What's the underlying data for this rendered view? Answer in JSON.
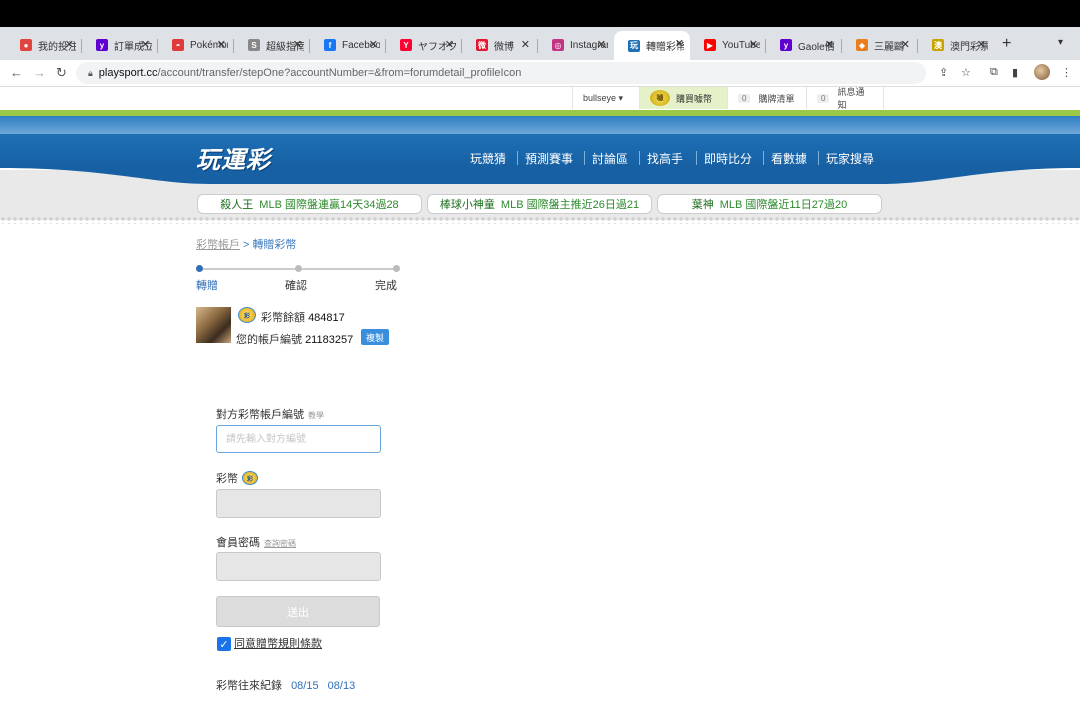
{
  "browser": {
    "tabs": [
      {
        "title": "我的投注",
        "fav_color": "#e0443e",
        "fav_glyph": "●"
      },
      {
        "title": "訂單成立",
        "fav_color": "#5f01d1",
        "fav_glyph": "y"
      },
      {
        "title": "Pokémon",
        "fav_color": "#e03a3a",
        "fav_glyph": "◓"
      },
      {
        "title": "超級指南",
        "fav_color": "#888888",
        "fav_glyph": "S"
      },
      {
        "title": "Facebook",
        "fav_color": "#1877f2",
        "fav_glyph": "f"
      },
      {
        "title": "ヤフオク",
        "fav_color": "#ff0033",
        "fav_glyph": "Y"
      },
      {
        "title": "微博",
        "fav_color": "#e6162d",
        "fav_glyph": "微"
      },
      {
        "title": "Instagram",
        "fav_color": "#c13584",
        "fav_glyph": "◎"
      },
      {
        "title": "轉贈彩幣",
        "fav_color": "#1f6fb5",
        "fav_glyph": "玩",
        "active": true
      },
      {
        "title": "YouTube",
        "fav_color": "#ff0000",
        "fav_glyph": "▶"
      },
      {
        "title": "Gaole價",
        "fav_color": "#5f01d1",
        "fav_glyph": "y"
      },
      {
        "title": "三麗鷗",
        "fav_color": "#e87f1c",
        "fav_glyph": "◆"
      },
      {
        "title": "澳門彩票",
        "fav_color": "#c9a300",
        "fav_glyph": "澳"
      }
    ],
    "url_host": "playsport.cc",
    "url_path": "/account/transfer/stepOne?accountNumber=&from=forumdetail_profileIcon"
  },
  "util": {
    "user": "bullseye",
    "buy_coin": "購買噱幣",
    "coin_logo": "噱",
    "cart_count": "0",
    "cart_label": "購牌清單",
    "notice_count": "0",
    "notice_label": "訊息通知"
  },
  "header": {
    "logo": "玩運彩",
    "nav": [
      "玩競猜",
      "預測賽事",
      "討論區",
      "找高手",
      "即時比分",
      "看數據",
      "玩家搜尋"
    ]
  },
  "tickers": [
    {
      "name": "殺人王",
      "text": "MLB 國際盤連贏14天34過28"
    },
    {
      "name": "棒球小神童",
      "text": "MLB 國際盤主推近26日過21"
    },
    {
      "name": "葉神",
      "text": "MLB 國際盤近11日27過20"
    }
  ],
  "breadcrumb": {
    "parent": "彩幣帳戶",
    "sep": ">",
    "current": "轉贈彩幣"
  },
  "steps": [
    "轉贈",
    "確認",
    "完成"
  ],
  "account": {
    "balance_label": "彩幣餘額",
    "balance": "484817",
    "acct_label": "您的帳戶編號",
    "acct_no": "21183257",
    "copy": "複製",
    "coin_mark": "彩"
  },
  "form": {
    "recv_label": "對方彩幣帳戶編號",
    "recv_hint": "教學",
    "recv_placeholder": "請先輸入對方編號",
    "coins_label": "彩幣",
    "pwd_label": "會員密碼",
    "pwd_hint": "查詢密碼",
    "submit": "送出",
    "agree": "同意贈幣規則條款"
  },
  "history": {
    "label": "彩幣往來紀錄",
    "dates": [
      "08/15",
      "08/13"
    ]
  }
}
